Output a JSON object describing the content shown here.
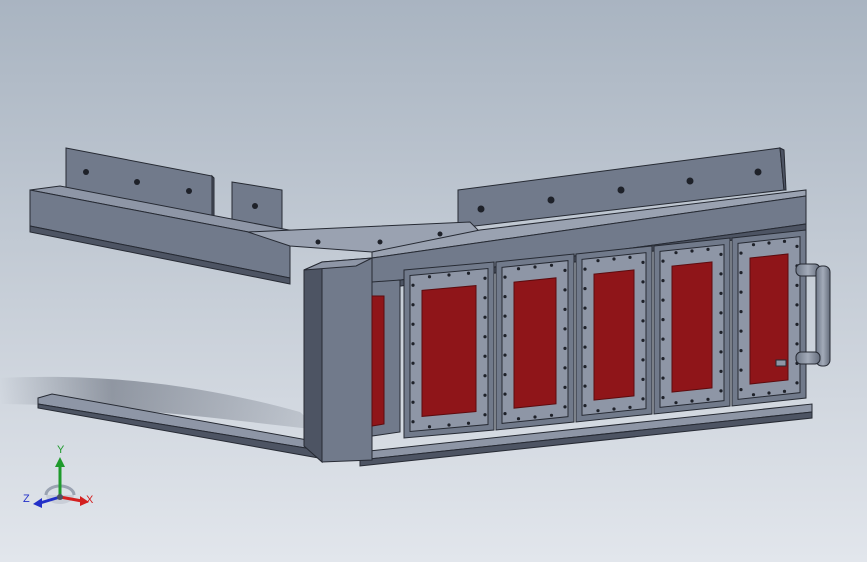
{
  "viewport": {
    "background_top": "#a9b4c1",
    "background_bottom": "#e2e6ec"
  },
  "colors": {
    "metal_light": "#8e96a6",
    "metal_mid": "#717a8b",
    "metal_dark": "#4d5463",
    "metal_darkest": "#353a45",
    "edge": "#262a33",
    "hole": "#1e2129",
    "panel_red": "#8f1519",
    "panel_red_edge": "#5c0b0e",
    "handle": "#8c95a5"
  },
  "triad": {
    "x_label": "X",
    "y_label": "Y",
    "z_label": "Z",
    "x_color": "#d42020",
    "y_color": "#1e9a2c",
    "z_color": "#2330c8",
    "icon": "coordinate-triad-icon"
  }
}
